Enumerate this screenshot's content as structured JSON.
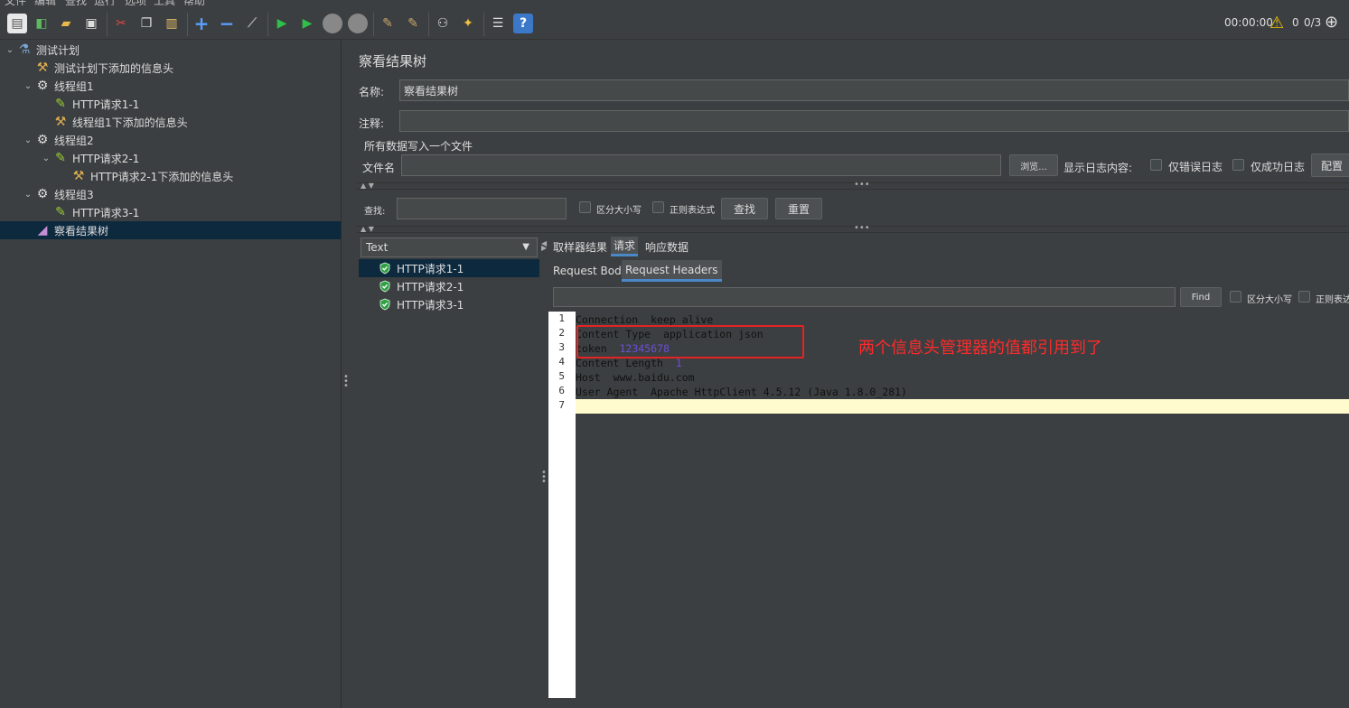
{
  "menu": [
    "文件",
    "编辑",
    "查找",
    "运行",
    "选项",
    "工具",
    "帮助"
  ],
  "status": {
    "timer": "00:00:00",
    "warnings": "0",
    "threads": "0/3"
  },
  "tree": [
    {
      "label": "测试计划",
      "icon": "flask-icon",
      "indent": 0,
      "toggle": "⌄",
      "color": "#7aa6d6"
    },
    {
      "label": "测试计划下添加的信息头",
      "icon": "wrench-icon",
      "indent": 1,
      "toggle": "",
      "color": "#e0b050"
    },
    {
      "label": "线程组1",
      "icon": "gear-icon",
      "indent": 1,
      "toggle": "⌄",
      "color": "#dddddd"
    },
    {
      "label": "HTTP请求1-1",
      "icon": "pipette-icon",
      "indent": 2,
      "toggle": "",
      "color": "#9acd32"
    },
    {
      "label": "线程组1下添加的信息头",
      "icon": "wrench-icon",
      "indent": 2,
      "toggle": "",
      "color": "#e0b050"
    },
    {
      "label": "线程组2",
      "icon": "gear-icon",
      "indent": 1,
      "toggle": "⌄",
      "color": "#dddddd"
    },
    {
      "label": "HTTP请求2-1",
      "icon": "pipette-icon",
      "indent": 2,
      "toggle": "⌄",
      "color": "#9acd32"
    },
    {
      "label": "HTTP请求2-1下添加的信息头",
      "icon": "wrench-icon",
      "indent": 3,
      "toggle": "",
      "color": "#e0b050"
    },
    {
      "label": "线程组3",
      "icon": "gear-icon",
      "indent": 1,
      "toggle": "⌄",
      "color": "#dddddd"
    },
    {
      "label": "HTTP请求3-1",
      "icon": "pipette-icon",
      "indent": 2,
      "toggle": "",
      "color": "#9acd32"
    },
    {
      "label": "察看结果树",
      "icon": "chart-icon",
      "indent": 1,
      "toggle": "",
      "color": "#c58fd6",
      "selected": true
    }
  ],
  "panel": {
    "title": "察看结果树",
    "name_label": "名称:",
    "name_value": "察看结果树",
    "comment_label": "注释:",
    "comment_value": "",
    "file_section": "所有数据写入一个文件",
    "filename_label": "文件名",
    "filename_value": "",
    "browse_button": "浏览...",
    "log_label": "显示日志内容:",
    "errors_only": "仅错误日志",
    "success_only": "仅成功日志",
    "config_button": "配置"
  },
  "search": {
    "label": "查找:",
    "value": "",
    "case_sensitive": "区分大小写",
    "regex": "正则表达式",
    "find_button": "查找",
    "reset_button": "重置"
  },
  "renderer": {
    "selected": "Text"
  },
  "results": [
    "HTTP请求1-1",
    "HTTP请求2-1",
    "HTTP请求3-1"
  ],
  "tabs": [
    "取样器结果",
    "请求",
    "响应数据"
  ],
  "subtabs": [
    "Request Body",
    "Request Headers"
  ],
  "inner_search": {
    "value": "",
    "find_button": "Find",
    "case_sensitive": "区分大小写",
    "regex": "正则表达式"
  },
  "headers": [
    {
      "n": "1",
      "key": "Connection",
      "val": "keep alive"
    },
    {
      "n": "2",
      "key": "Content Type",
      "val": "application json"
    },
    {
      "n": "3",
      "key": "token",
      "val": "12345678"
    },
    {
      "n": "4",
      "key": "Content Length",
      "val": "1"
    },
    {
      "n": "5",
      "key": "Host",
      "val": "www.baidu.com"
    },
    {
      "n": "6",
      "key": "User Agent",
      "val": "Apache HttpClient 4.5.12 (Java 1.8.0_281)"
    },
    {
      "n": "7",
      "key": "",
      "val": ""
    }
  ],
  "annotation": "两个信息头管理器的值都引用到了",
  "colors": {
    "selection": "#0d293e",
    "accent": "#4a88c7",
    "annotation": "#ff2a2a"
  }
}
